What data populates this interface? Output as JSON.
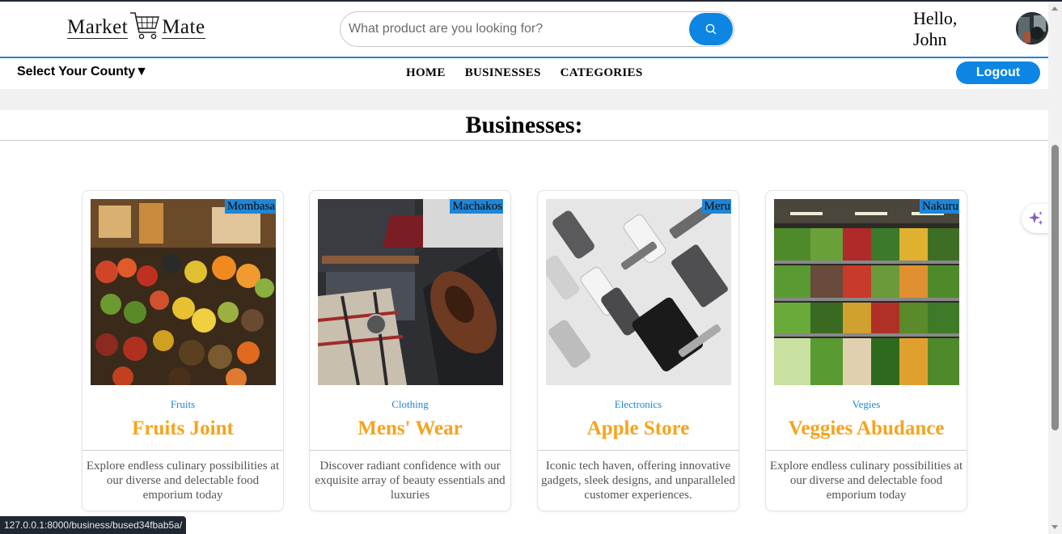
{
  "brand": {
    "word1": "Market",
    "word2": "Mate"
  },
  "search": {
    "placeholder": "What product are you looking for?"
  },
  "greeting": "Hello, John",
  "nav": {
    "county_select": "Select Your County▼",
    "links": [
      "HOME",
      "BUSINESSES",
      "CATEGORIES"
    ],
    "logout": "Logout"
  },
  "section_title": "Businesses:",
  "businesses": [
    {
      "location": "Mombasa",
      "category": "Fruits",
      "name": "Fruits Joint",
      "description": "Explore endless culinary possibilities at our diverse and delectable food emporium today",
      "image": "fruit-market-photo"
    },
    {
      "location": "Machakos",
      "category": "Clothing",
      "name": "Mens' Wear",
      "description": "Discover radiant confidence with our exquisite array of beauty essentials and luxuries",
      "image": "menswear-flatlay-photo"
    },
    {
      "location": "Meru",
      "category": "Electronics",
      "name": "Apple Store",
      "description": "Iconic tech haven, offering innovative gadgets, sleek designs, and unparalleled customer experiences.",
      "image": "apple-devices-photo"
    },
    {
      "location": "Nakuru",
      "category": "Vegies",
      "name": "Veggies Abudance",
      "description": "Explore endless culinary possibilities at our diverse and delectable food emporium today",
      "image": "vegetable-shelves-photo"
    }
  ],
  "status_url": "127.0.0.1:8000/business/bused34fbab5a/",
  "colors": {
    "accent": "#0d86e3",
    "title_orange": "#f6a31c",
    "category_blue": "#1f86d6"
  }
}
